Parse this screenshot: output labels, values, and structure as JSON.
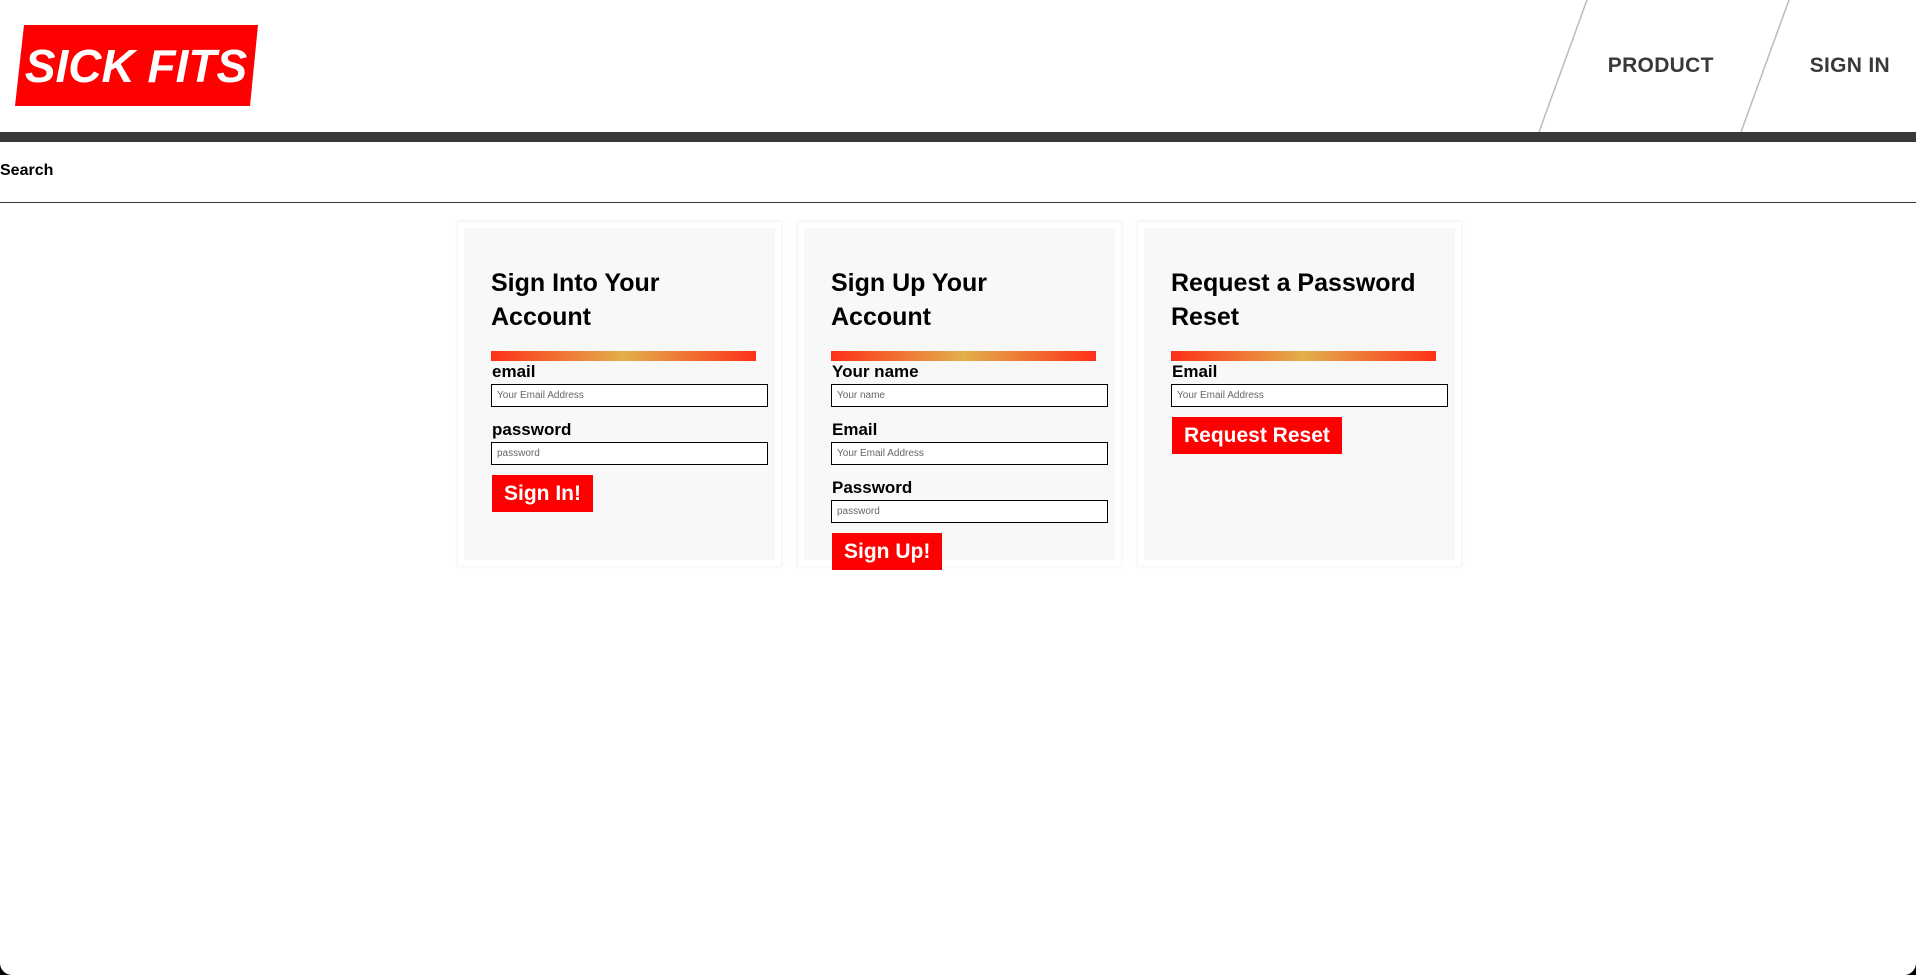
{
  "header": {
    "logo_text": "SICK FITS",
    "nav": [
      {
        "label": "PRODUCT"
      },
      {
        "label": "SIGN IN"
      }
    ],
    "brand_color": "#ff0000",
    "bar_color": "#393939"
  },
  "search": {
    "label": "Search"
  },
  "signin": {
    "title": "Sign Into Your Account",
    "email_label": "email",
    "email_placeholder": "Your Email Address",
    "password_label": "password",
    "password_placeholder": "password",
    "button": "Sign In!"
  },
  "signup": {
    "title": "Sign Up Your Account",
    "name_label": "Your name",
    "name_placeholder": "Your name",
    "email_label": "Email",
    "email_placeholder": "Your Email Address",
    "password_label": "Password",
    "password_placeholder": "password",
    "button": "Sign Up!"
  },
  "reset": {
    "title": "Request a Password Reset",
    "email_label": "Email",
    "email_placeholder": "Your Email Address",
    "button": "Request Reset"
  }
}
